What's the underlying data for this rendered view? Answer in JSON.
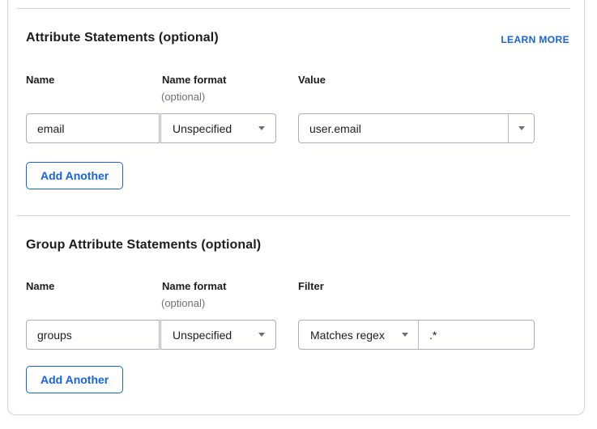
{
  "accent_color": "#1662dd",
  "sections": [
    {
      "title": "Attribute Statements (optional)",
      "learn_more_label": "LEARN MORE",
      "columns": {
        "name": "Name",
        "format": "Name format",
        "third": "Value"
      },
      "format_note": "(optional)",
      "row": {
        "name": "email",
        "name_format": "Unspecified",
        "value": "user.email"
      },
      "add_button_label": "Add Another"
    },
    {
      "title": "Group Attribute Statements (optional)",
      "columns": {
        "name": "Name",
        "format": "Name format",
        "third": "Filter"
      },
      "format_note": "(optional)",
      "row": {
        "name": "groups",
        "name_format": "Unspecified",
        "filter_type": "Matches regex",
        "filter_value": ".*"
      },
      "add_button_label": "Add Another"
    }
  ]
}
